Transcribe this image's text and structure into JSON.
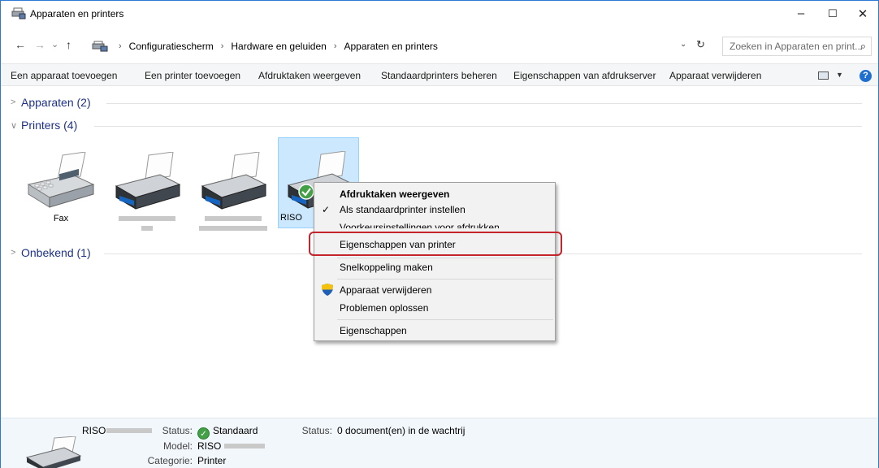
{
  "window": {
    "title": "Apparaten en printers",
    "controls": {
      "minimize": "–",
      "maximize": "☐",
      "close": "✕"
    }
  },
  "address": {
    "back": "←",
    "forward": "→",
    "history": "⌄",
    "up": "↑",
    "crumbs": [
      "Configuratiescherm",
      "Hardware en geluiden",
      "Apparaten en printers"
    ],
    "separator": "›",
    "dropdown": "⌄",
    "refresh": "↻",
    "search_placeholder": "Zoeken in Apparaten en print...",
    "search_icon": "⌕"
  },
  "commands": [
    "Een apparaat toevoegen",
    "Een printer toevoegen",
    "Afdruktaken weergeven",
    "Standaardprinters beheren",
    "Eigenschappen van afdrukserver",
    "Apparaat verwijderen"
  ],
  "help_label": "?",
  "groups": {
    "devices": {
      "label": "Apparaten (2)",
      "chevron": ">"
    },
    "printers": {
      "label": "Printers (4)",
      "chevron": "∨"
    },
    "unknown": {
      "label": "Onbekend (1)",
      "chevron": ">"
    }
  },
  "printers": [
    {
      "label": "Fax",
      "icon": "fax-icon"
    },
    {
      "label": "",
      "icon": "printer-icon"
    },
    {
      "label": "",
      "icon": "printer-icon"
    },
    {
      "label": "RISO",
      "icon": "printer-icon",
      "is_default": true
    }
  ],
  "context_menu": {
    "items": [
      {
        "label": "Afdruktaken weergeven",
        "bold": true
      },
      {
        "label": "Als standaardprinter instellen",
        "lead": "✓"
      },
      {
        "label": "Voorkeursinstellingen voor afdrukken"
      },
      {
        "label": "Eigenschappen van printer",
        "highlighted": true
      },
      {
        "label": "Snelkoppeling maken"
      },
      {
        "label": "Apparaat verwijderen",
        "icon": "shield-icon"
      },
      {
        "label": "Problemen oplossen"
      },
      {
        "label": "Eigenschappen"
      }
    ]
  },
  "details": {
    "name": "RISO",
    "status_label": "Status:",
    "status_value": "Standaard",
    "status2_label": "Status:",
    "status2_value": "0 document(en) in de wachtrij",
    "model_label": "Model:",
    "model_value": "RISO",
    "category_label": "Categorie:",
    "category_value": "Printer"
  },
  "colors": {
    "accent": "#2b79d6",
    "group_header": "#1e3287",
    "selection": "#cce8ff",
    "highlight_box": "#c4242b",
    "default_check": "#43a047"
  }
}
